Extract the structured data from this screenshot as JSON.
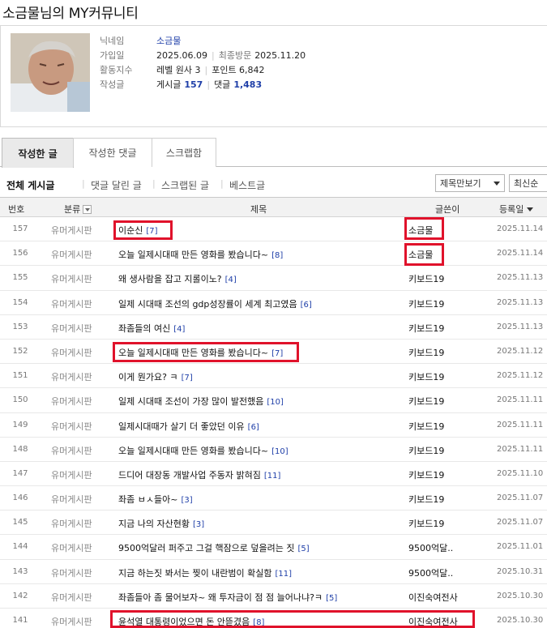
{
  "page_title": "소금물님의 MY커뮤니티",
  "profile": {
    "nickname_label": "닉네임",
    "nickname": "소금물",
    "joined_label": "가입일",
    "joined": "2025.06.09",
    "last_visit_label": "최종방문",
    "last_visit": "2025.11.20",
    "activity_label": "활동지수",
    "level": "레벨 원사 3",
    "points": "포인트 6,842",
    "posts_label": "작성글",
    "post_count_label": "게시글",
    "post_count": "157",
    "comment_count_label": "댓글",
    "comment_count": "1,483"
  },
  "tabs": [
    "작성한 글",
    "작성한 댓글",
    "스크랩함"
  ],
  "subnav": [
    "전체 게시글",
    "댓글 달린 글",
    "스크랩된 글",
    "베스트글"
  ],
  "view_select": "제목만보기",
  "sort_select": "최신순",
  "columns": {
    "no": "번호",
    "board": "분류",
    "title": "제목",
    "author": "글쓴이",
    "date": "등록일"
  },
  "rows": [
    {
      "no": "157",
      "board": "유머게시판",
      "title": "이순신",
      "comments": "[7]",
      "author": "소금물",
      "date": "2025.11.14"
    },
    {
      "no": "156",
      "board": "유머게시판",
      "title": "오늘 일제시대때 만든 영화를 봤습니다~",
      "comments": "[8]",
      "author": "소금물",
      "date": "2025.11.14"
    },
    {
      "no": "155",
      "board": "유머게시판",
      "title": "왜 생사람을 잡고 지롤이노?",
      "comments": "[4]",
      "author": "키보드19",
      "date": "2025.11.13"
    },
    {
      "no": "154",
      "board": "유머게시판",
      "title": "일제 시대때 조선의 gdp성장률이 세계 최고였음",
      "comments": "[6]",
      "author": "키보드19",
      "date": "2025.11.13"
    },
    {
      "no": "153",
      "board": "유머게시판",
      "title": "좌좀들의 여신",
      "comments": "[4]",
      "author": "키보드19",
      "date": "2025.11.13"
    },
    {
      "no": "152",
      "board": "유머게시판",
      "title": "오늘 일제시대때 만든 영화를 봤습니다~",
      "comments": "[7]",
      "author": "키보드19",
      "date": "2025.11.12"
    },
    {
      "no": "151",
      "board": "유머게시판",
      "title": "이게 뭔가요? ㅋ",
      "comments": "[7]",
      "author": "키보드19",
      "date": "2025.11.12"
    },
    {
      "no": "150",
      "board": "유머게시판",
      "title": "일제 시대때 조선이 가장 많이 발전했음",
      "comments": "[10]",
      "author": "키보드19",
      "date": "2025.11.11"
    },
    {
      "no": "149",
      "board": "유머게시판",
      "title": "일제시대때가 살기 더 좋았던 이유",
      "comments": "[6]",
      "author": "키보드19",
      "date": "2025.11.11"
    },
    {
      "no": "148",
      "board": "유머게시판",
      "title": "오늘 일제시대때 만든 영화를 봤습니다~",
      "comments": "[10]",
      "author": "키보드19",
      "date": "2025.11.11"
    },
    {
      "no": "147",
      "board": "유머게시판",
      "title": "드디어 대장동 개발사업 주동자 밝혀짐",
      "comments": "[11]",
      "author": "키보드19",
      "date": "2025.11.10"
    },
    {
      "no": "146",
      "board": "유머게시판",
      "title": "좌좀 ㅂㅅ들아~",
      "comments": "[3]",
      "author": "키보드19",
      "date": "2025.11.07"
    },
    {
      "no": "145",
      "board": "유머게시판",
      "title": "지금 나의 자산현황",
      "comments": "[3]",
      "author": "키보드19",
      "date": "2025.11.07"
    },
    {
      "no": "144",
      "board": "유머게시판",
      "title": "9500억달러 퍼주고 그걸 핵잠으로 덮을려는 짓",
      "comments": "[5]",
      "author": "9500억달..",
      "date": "2025.11.01"
    },
    {
      "no": "143",
      "board": "유머게시판",
      "title": "지금 하는짓 봐서는 찢이 내란범이 확실함",
      "comments": "[11]",
      "author": "9500억달..",
      "date": "2025.10.31"
    },
    {
      "no": "142",
      "board": "유머게시판",
      "title": "좌좀들아 좀 물어보자~ 왜 투자금이 점 점 늘어나냐?ㅋ",
      "comments": "[5]",
      "author": "이진숙여전사",
      "date": "2025.10.30"
    },
    {
      "no": "141",
      "board": "유머게시판",
      "title": "윤석열 대통령이었으면 돈 안뜯겼음",
      "comments": "[8]",
      "author": "이진숙여전사",
      "date": "2025.10.30"
    }
  ],
  "colors": {
    "highlight": "#e0122b",
    "link": "#1f3fa8"
  }
}
